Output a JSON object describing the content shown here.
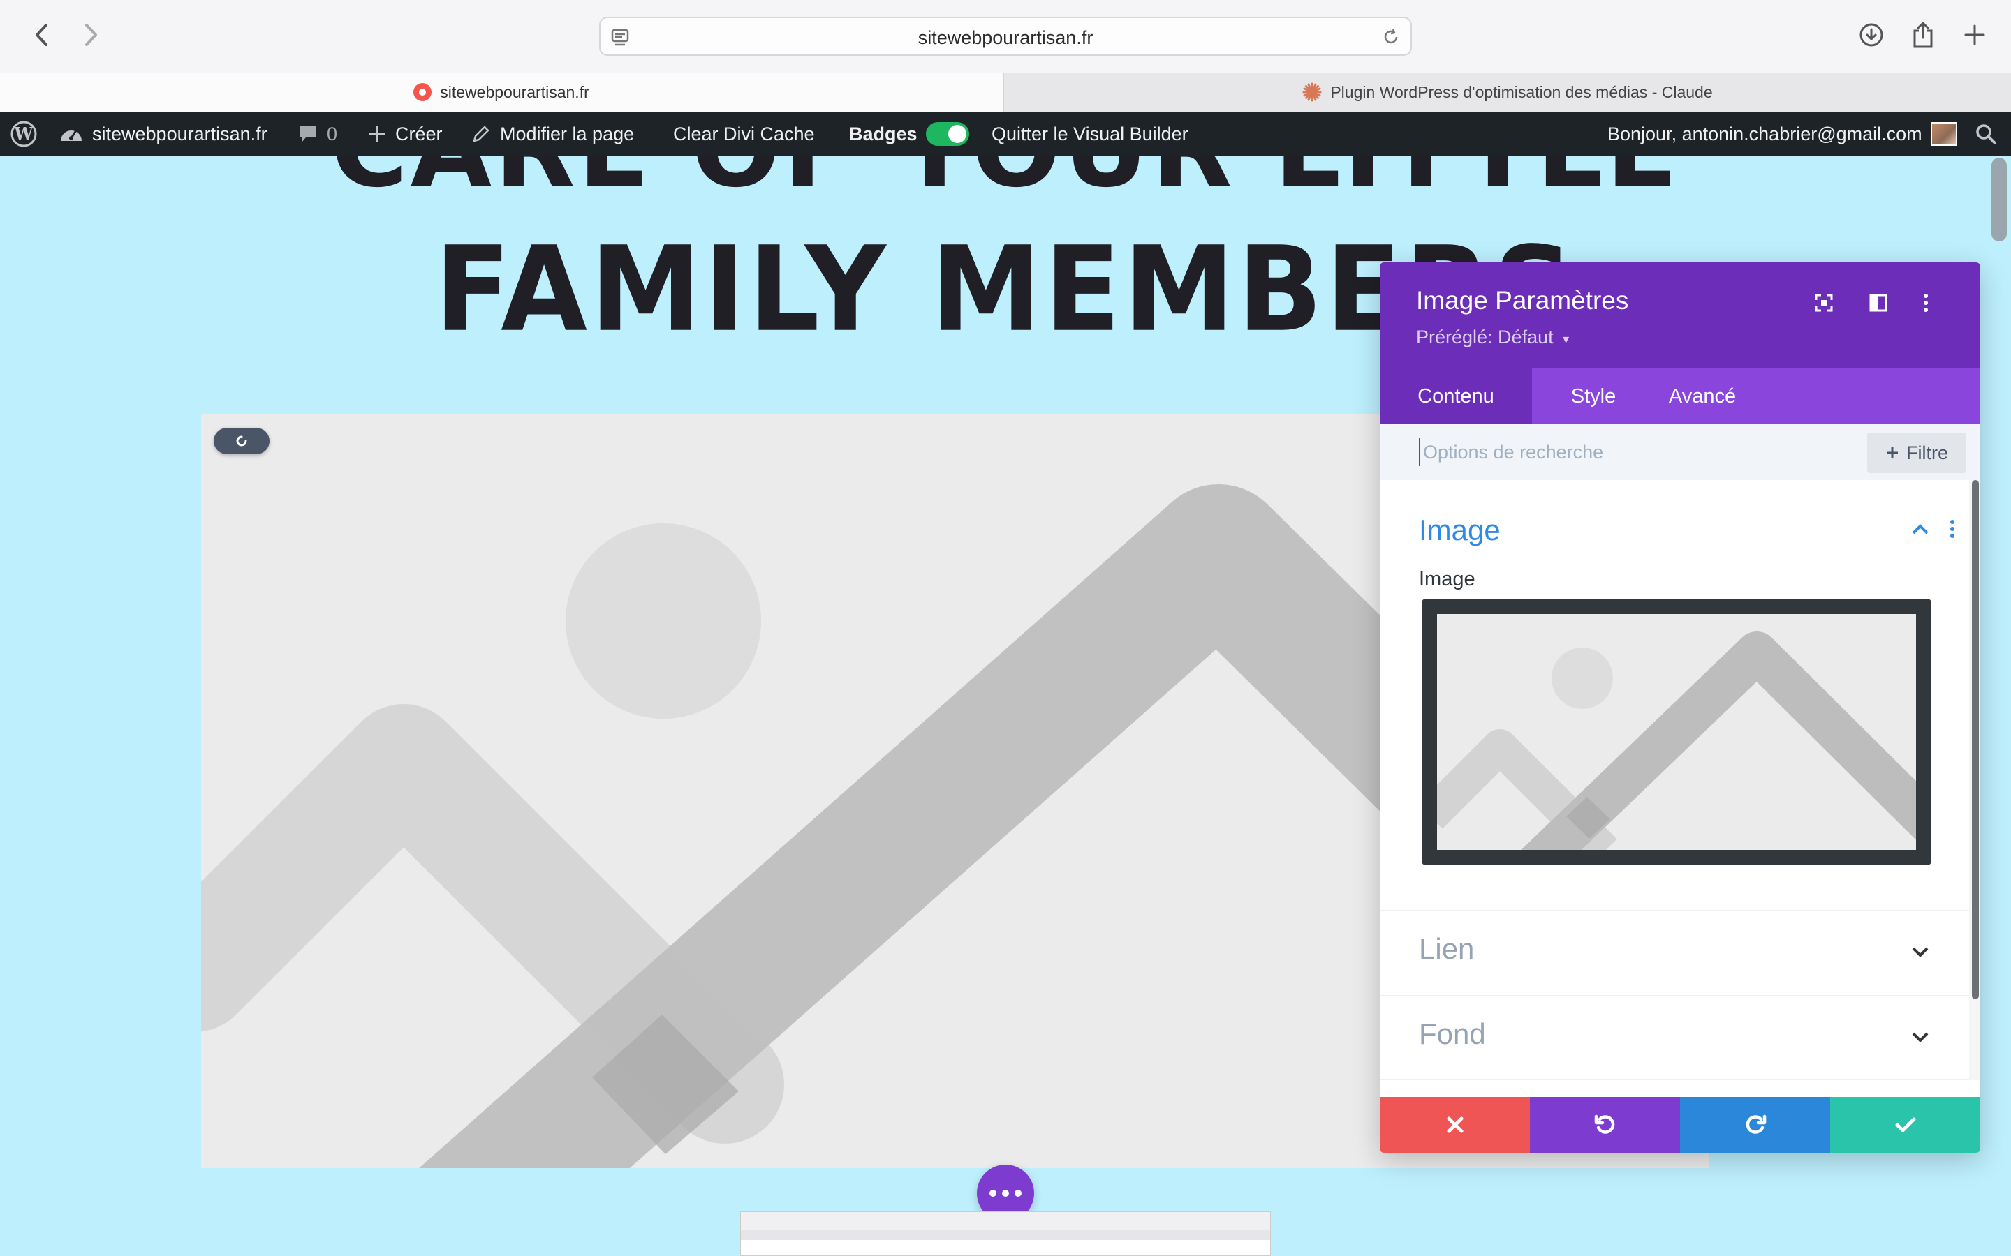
{
  "browser": {
    "url": "sitewebpourartisan.fr",
    "tabs": [
      {
        "title": "sitewebpourartisan.fr",
        "active": true
      },
      {
        "title": "Plugin WordPress d'optimisation des médias - Claude",
        "active": false
      }
    ]
  },
  "admin_bar": {
    "site_name": "sitewebpourartisan.fr",
    "comments_count": "0",
    "create_label": "Créer",
    "edit_page_label": "Modifier la page",
    "clear_cache_label": "Clear Divi Cache",
    "badges_label": "Badges",
    "badges_enabled": true,
    "exit_builder_label": "Quitter le Visual Builder",
    "greeting": "Bonjour, antonin.chabrier@gmail.com"
  },
  "page": {
    "heading_line1": "CARE OF YOUR LITTLE",
    "heading_line2": "FAMILY MEMBERS"
  },
  "settings_panel": {
    "title": "Image Paramètres",
    "preset": "Préréglé: Défaut",
    "tabs": [
      {
        "label": "Contenu",
        "active": true
      },
      {
        "label": "Style",
        "active": false
      },
      {
        "label": "Avancé",
        "active": false
      }
    ],
    "search_placeholder": "Options de recherche",
    "filter_label": "Filtre",
    "groups": [
      {
        "title": "Image",
        "expanded": true,
        "field_label": "Image"
      },
      {
        "title": "Lien",
        "expanded": false
      },
      {
        "title": "Fond",
        "expanded": false
      }
    ]
  },
  "colors": {
    "divi_purple": "#6c2eb9",
    "divi_tab_purple": "#8a45dd",
    "discard_red": "#ef5555",
    "redo_blue": "#2b87da",
    "save_green": "#29c4a9",
    "page_background": "#bdeffd",
    "wp_admin_bar": "#1d2327"
  }
}
